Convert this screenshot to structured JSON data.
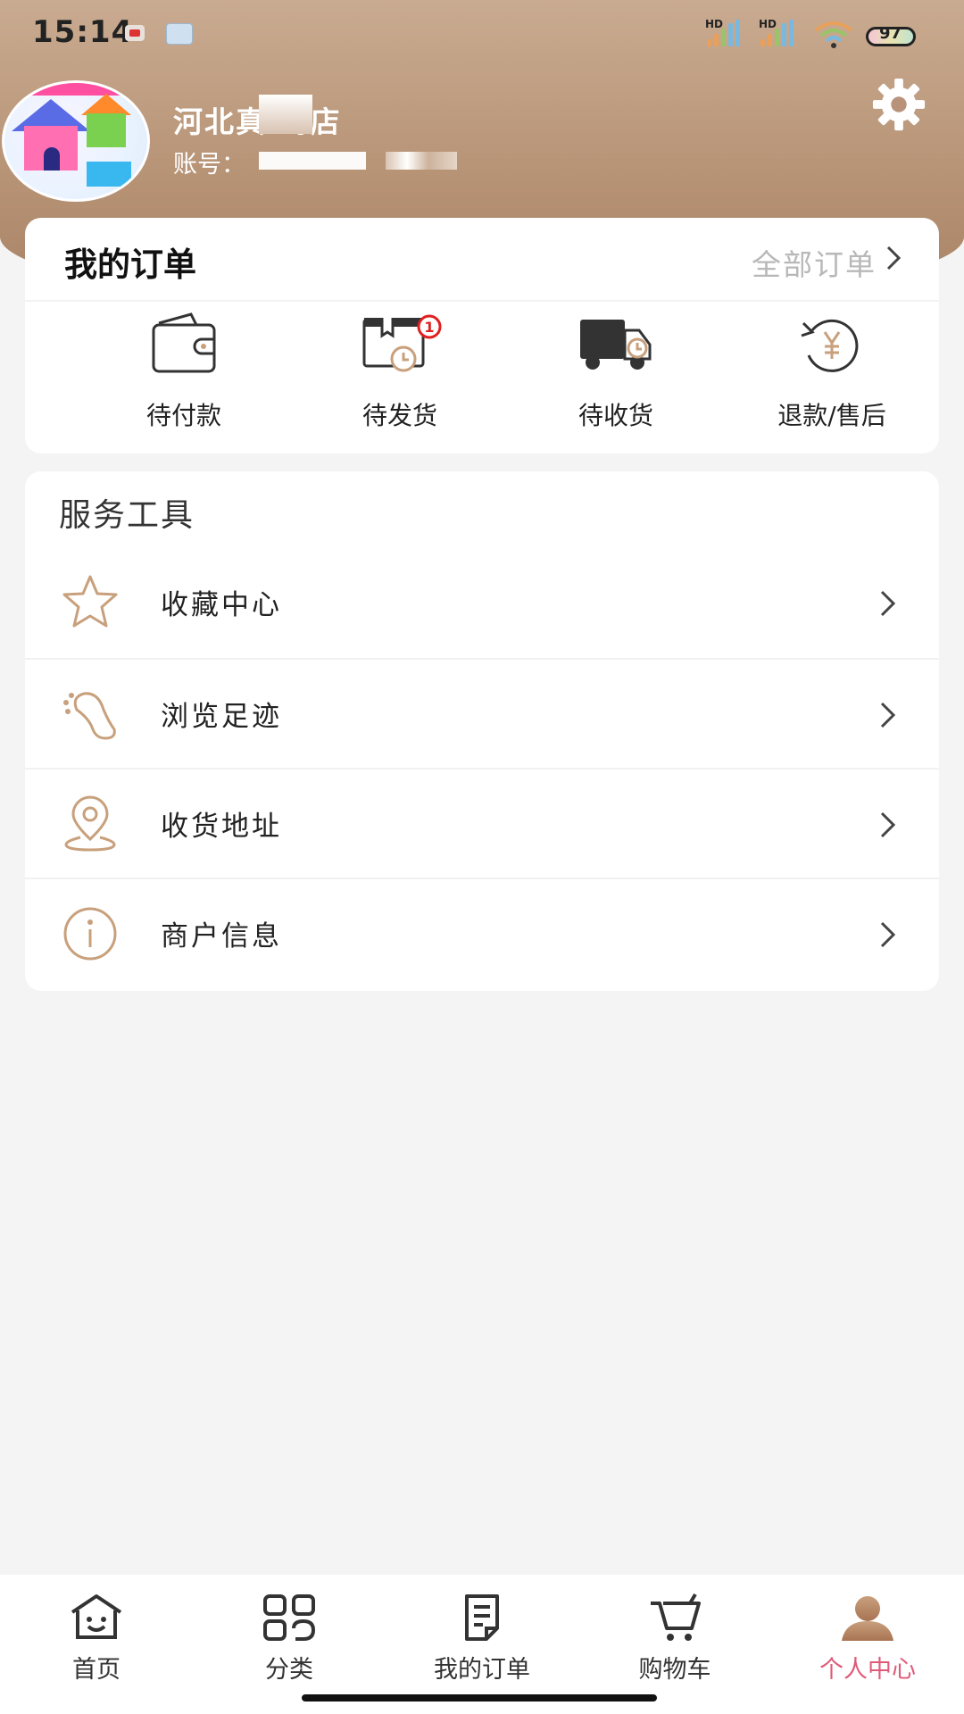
{
  "status_bar": {
    "time": "15:14",
    "signal_1_label": "HD",
    "signal_2_label": "HD",
    "battery": "97"
  },
  "profile": {
    "store_name": "河北真 药店",
    "account_label": "账号："
  },
  "orders": {
    "title": "我的订单",
    "all_orders_label": "全部订单",
    "items": [
      {
        "label": "待付款",
        "icon": "wallet-icon"
      },
      {
        "label": "待发货",
        "icon": "package-clock-icon",
        "badge": "1"
      },
      {
        "label": "待收货",
        "icon": "delivery-truck-icon"
      },
      {
        "label": "退款/售后",
        "icon": "refund-yen-icon"
      }
    ]
  },
  "tools": {
    "title": "服务工具",
    "items": [
      {
        "label": "收藏中心",
        "icon": "star-icon"
      },
      {
        "label": "浏览足迹",
        "icon": "footprint-icon"
      },
      {
        "label": "收货地址",
        "icon": "location-pin-icon"
      },
      {
        "label": "商户信息",
        "icon": "info-icon"
      }
    ]
  },
  "tabbar": {
    "items": [
      {
        "label": "首页",
        "icon": "home-icon"
      },
      {
        "label": "分类",
        "icon": "category-icon"
      },
      {
        "label": "我的订单",
        "icon": "order-list-icon"
      },
      {
        "label": "购物车",
        "icon": "cart-icon"
      },
      {
        "label": "个人中心",
        "icon": "person-icon",
        "active": true
      }
    ]
  },
  "colors": {
    "accent": "#c8a07c",
    "active_tab": "#e05a78",
    "header_gradient_top": "#c9ab91",
    "header_gradient_bottom": "#a88163"
  }
}
